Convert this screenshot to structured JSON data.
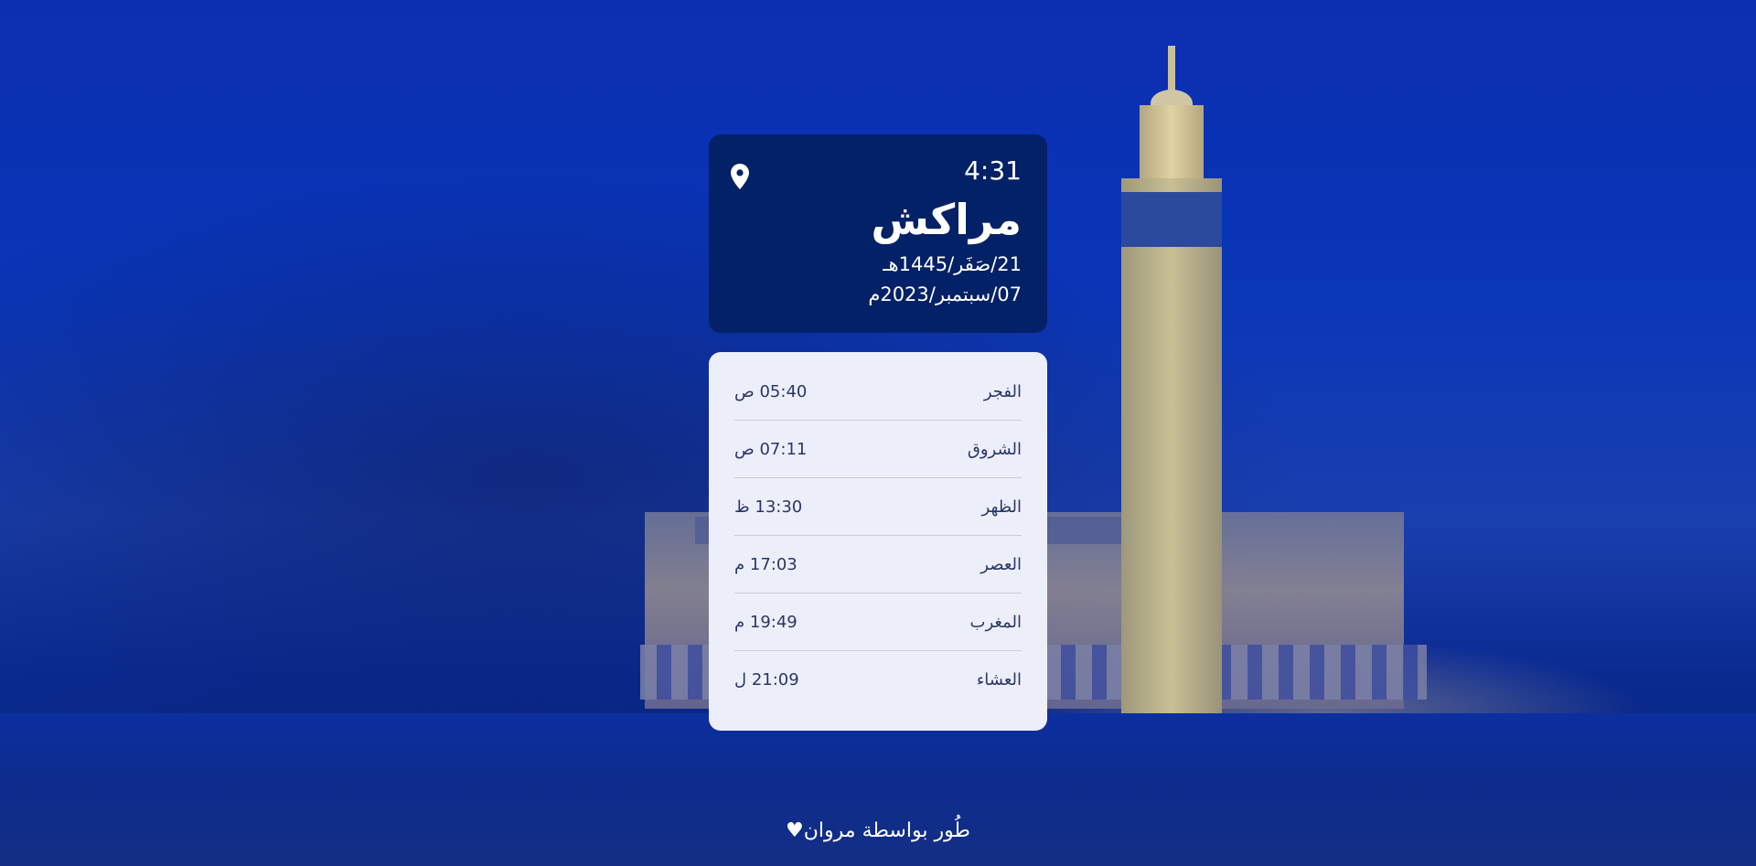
{
  "header": {
    "time": "4:31",
    "city": "مراكش",
    "hijri_date": "21/صَفَر/1445هـ",
    "gregorian_date": "07/سبتمبر/2023م",
    "location_icon": "map-pin-icon"
  },
  "prayers": [
    {
      "name": "الفجر",
      "time": "05:40 ص"
    },
    {
      "name": "الشروق",
      "time": "07:11 ص"
    },
    {
      "name": "الظهر",
      "time": "13:30 ظ"
    },
    {
      "name": "العصر",
      "time": "17:03 م"
    },
    {
      "name": "المغرب",
      "time": "19:49 م"
    },
    {
      "name": "العشاء",
      "time": "21:09 ل"
    }
  ],
  "footer": {
    "credit": "طُور بواسطة مروان♥"
  },
  "colors": {
    "header_bg": "#032166",
    "card_bg": "#eceff9",
    "text_dark": "#2a3569",
    "background": "#0b2a8f"
  }
}
